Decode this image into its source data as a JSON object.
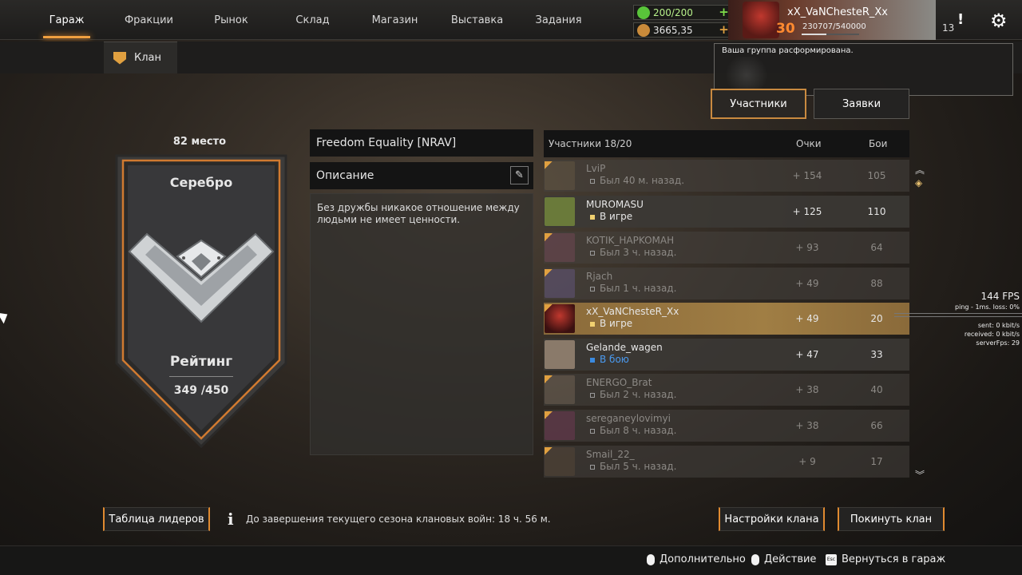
{
  "nav": {
    "tabs": [
      "Гараж",
      "Фракции",
      "Рынок",
      "Склад",
      "Магазин",
      "Выставка",
      "Задания"
    ],
    "active": "Гараж"
  },
  "resources": {
    "fuel": "200/200",
    "coins": "3665,35"
  },
  "profile": {
    "name": "xX_VaNChesteR_Xx",
    "level": "30",
    "xp": "230707/540000",
    "xp_progress": 0.43
  },
  "header": {
    "notif_count": "13"
  },
  "subtab": {
    "label": "Клан"
  },
  "popup": {
    "text": "Ваша группа расформирована."
  },
  "tabs": {
    "members": "Участники",
    "requests": "Заявки"
  },
  "rank": {
    "place": "82 место",
    "league": "Серебро",
    "rating_label": "Рейтинг",
    "rating_value": "349 /450"
  },
  "clan": {
    "name": "Freedom Equality [NRAV]",
    "desc_title": "Описание",
    "desc_text": "Без дружбы никакое отношение между людьми не имеет ценности."
  },
  "table": {
    "members_label": "Участники 18/20",
    "col_points": "Очки",
    "col_battles": "Бои",
    "rows": [
      {
        "name": "LviP",
        "status": "Был 40 м. назад.",
        "points": "+ 154",
        "battles": "105"
      },
      {
        "name": "MUROMASU",
        "status": "В игре",
        "points": "+ 125",
        "battles": "110"
      },
      {
        "name": "KOTIK_HAPKOMAH",
        "status": "Был 3 ч. назад.",
        "points": "+ 93",
        "battles": "64"
      },
      {
        "name": "Rjach",
        "status": "Был 1 ч. назад.",
        "points": "+ 49",
        "battles": "88"
      },
      {
        "name": "xX_VaNChesteR_Xx",
        "status": "В игре",
        "points": "+ 49",
        "battles": "20"
      },
      {
        "name": "Gelande_wagen",
        "status": "В бою",
        "points": "+ 47",
        "battles": "33"
      },
      {
        "name": "ENERGO_Brat",
        "status": "Был 2 ч. назад.",
        "points": "+ 38",
        "battles": "40"
      },
      {
        "name": "sereganeylovimyi",
        "status": "Был 8 ч. назад.",
        "points": "+ 38",
        "battles": "66"
      },
      {
        "name": "Smail_22_",
        "status": "Был 5 ч. назад.",
        "points": "+ 9",
        "battles": "17"
      }
    ]
  },
  "stats": {
    "fps": "144 FPS",
    "ping": "ping - 1ms. loss: 0%",
    "sent": "sent: 0 kbit/s",
    "received": "received: 0 kbit/s",
    "server": "serverFps: 29"
  },
  "buttons": {
    "leaders": "Таблица лидеров",
    "settings": "Настройки клана",
    "leave": "Покинуть клан"
  },
  "season": {
    "text": "До завершения текущего сезона клановых войн: 18 ч. 56 м."
  },
  "hints": {
    "more": "Дополнительно",
    "action": "Действие",
    "back": "Вернуться в гараж",
    "esc_key": "Esc"
  }
}
